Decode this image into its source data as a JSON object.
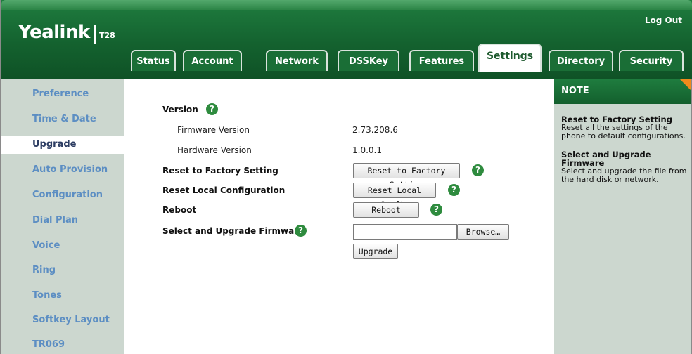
{
  "header": {
    "logo": "Yealink",
    "model": "T28",
    "logout": "Log Out"
  },
  "tabs": [
    {
      "label": "Status",
      "active": false
    },
    {
      "label": "Account",
      "active": false
    },
    {
      "label": "Network",
      "active": false
    },
    {
      "label": "DSSKey",
      "active": false
    },
    {
      "label": "Features",
      "active": false
    },
    {
      "label": "Settings",
      "active": true
    },
    {
      "label": "Directory",
      "active": false
    },
    {
      "label": "Security",
      "active": false
    }
  ],
  "sidebar": {
    "items": [
      {
        "label": "Preference",
        "active": false
      },
      {
        "label": "Time & Date",
        "active": false
      },
      {
        "label": "Upgrade",
        "active": true
      },
      {
        "label": "Auto Provision",
        "active": false
      },
      {
        "label": "Configuration",
        "active": false
      },
      {
        "label": "Dial Plan",
        "active": false
      },
      {
        "label": "Voice",
        "active": false
      },
      {
        "label": "Ring",
        "active": false
      },
      {
        "label": "Tones",
        "active": false
      },
      {
        "label": "Softkey Layout",
        "active": false
      },
      {
        "label": "TR069",
        "active": false
      }
    ]
  },
  "main": {
    "version_label": "Version",
    "firmware_label": "Firmware Version",
    "firmware_value": "2.73.208.6",
    "hardware_label": "Hardware Version",
    "hardware_value": "1.0.0.1",
    "reset_factory_label": "Reset to Factory Setting",
    "reset_factory_button": "Reset to Factory Setting",
    "reset_local_label": "Reset Local Configuration",
    "reset_local_button": "Reset Local Config",
    "reboot_label": "Reboot",
    "reboot_button": "Reboot",
    "upgrade_fw_label": "Select and Upgrade Firmware",
    "file_value": "",
    "browse_button": "Browse…",
    "upgrade_button": "Upgrade",
    "help_glyph": "?"
  },
  "note": {
    "heading": "NOTE",
    "sections": [
      {
        "title": "Reset to Factory Setting",
        "text": [
          "Reset all the settings of the",
          "phone to default configurations."
        ]
      },
      {
        "title": "Select and Upgrade Firmware",
        "text": [
          "Select and upgrade the file from",
          "the hard disk or network."
        ]
      }
    ]
  },
  "colors": {
    "brand_green": "#1f7d3f",
    "sidebar_bg": "#ccd7cf",
    "sidebar_link": "#5c8ec3",
    "help_icon": "#2e8b3e",
    "note_corner": "#f08a1c"
  }
}
